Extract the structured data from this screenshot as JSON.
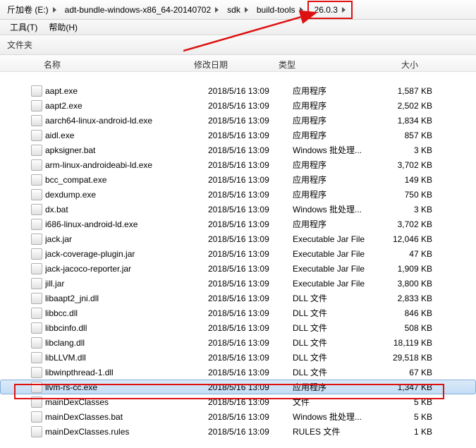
{
  "breadcrumb": [
    {
      "label": "斤加卷 (E:)"
    },
    {
      "label": "adt-bundle-windows-x86_64-20140702"
    },
    {
      "label": "sdk"
    },
    {
      "label": "build-tools"
    },
    {
      "label": "26.0.3",
      "highlight": true
    }
  ],
  "menu": {
    "tools": "工具(T)",
    "help": "帮助(H)"
  },
  "toolbar": {
    "label": "文件夹"
  },
  "columns": {
    "name": "名称",
    "date": "修改日期",
    "type": "类型",
    "size": "大小"
  },
  "files": [
    {
      "name": "",
      "date": "",
      "type": "",
      "size": "",
      "truncated": true
    },
    {
      "name": "aapt.exe",
      "date": "2018/5/16 13:09",
      "type": "应用程序",
      "size": "1,587 KB"
    },
    {
      "name": "aapt2.exe",
      "date": "2018/5/16 13:09",
      "type": "应用程序",
      "size": "2,502 KB"
    },
    {
      "name": "aarch64-linux-android-ld.exe",
      "date": "2018/5/16 13:09",
      "type": "应用程序",
      "size": "1,834 KB"
    },
    {
      "name": "aidl.exe",
      "date": "2018/5/16 13:09",
      "type": "应用程序",
      "size": "857 KB"
    },
    {
      "name": "apksigner.bat",
      "date": "2018/5/16 13:09",
      "type": "Windows 批处理...",
      "size": "3 KB"
    },
    {
      "name": "arm-linux-androideabi-ld.exe",
      "date": "2018/5/16 13:09",
      "type": "应用程序",
      "size": "3,702 KB"
    },
    {
      "name": "bcc_compat.exe",
      "date": "2018/5/16 13:09",
      "type": "应用程序",
      "size": "149 KB"
    },
    {
      "name": "dexdump.exe",
      "date": "2018/5/16 13:09",
      "type": "应用程序",
      "size": "750 KB"
    },
    {
      "name": "dx.bat",
      "date": "2018/5/16 13:09",
      "type": "Windows 批处理...",
      "size": "3 KB"
    },
    {
      "name": "i686-linux-android-ld.exe",
      "date": "2018/5/16 13:09",
      "type": "应用程序",
      "size": "3,702 KB"
    },
    {
      "name": "jack.jar",
      "date": "2018/5/16 13:09",
      "type": "Executable Jar File",
      "size": "12,046 KB"
    },
    {
      "name": "jack-coverage-plugin.jar",
      "date": "2018/5/16 13:09",
      "type": "Executable Jar File",
      "size": "47 KB"
    },
    {
      "name": "jack-jacoco-reporter.jar",
      "date": "2018/5/16 13:09",
      "type": "Executable Jar File",
      "size": "1,909 KB"
    },
    {
      "name": "jill.jar",
      "date": "2018/5/16 13:09",
      "type": "Executable Jar File",
      "size": "3,800 KB"
    },
    {
      "name": "libaapt2_jni.dll",
      "date": "2018/5/16 13:09",
      "type": "DLL 文件",
      "size": "2,833 KB"
    },
    {
      "name": "libbcc.dll",
      "date": "2018/5/16 13:09",
      "type": "DLL 文件",
      "size": "846 KB"
    },
    {
      "name": "libbcinfo.dll",
      "date": "2018/5/16 13:09",
      "type": "DLL 文件",
      "size": "508 KB"
    },
    {
      "name": "libclang.dll",
      "date": "2018/5/16 13:09",
      "type": "DLL 文件",
      "size": "18,119 KB"
    },
    {
      "name": "libLLVM.dll",
      "date": "2018/5/16 13:09",
      "type": "DLL 文件",
      "size": "29,518 KB"
    },
    {
      "name": "libwinpthread-1.dll",
      "date": "2018/5/16 13:09",
      "type": "DLL 文件",
      "size": "67 KB"
    },
    {
      "name": "llvm-rs-cc.exe",
      "date": "2018/5/16 13:09",
      "type": "应用程序",
      "size": "1,347 KB",
      "selected": true
    },
    {
      "name": "mainDexClasses",
      "date": "2018/5/16 13:09",
      "type": "文件",
      "size": "5 KB"
    },
    {
      "name": "mainDexClasses.bat",
      "date": "2018/5/16 13:09",
      "type": "Windows 批处理...",
      "size": "5 KB"
    },
    {
      "name": "mainDexClasses.rules",
      "date": "2018/5/16 13:09",
      "type": "RULES 文件",
      "size": "1 KB"
    }
  ]
}
